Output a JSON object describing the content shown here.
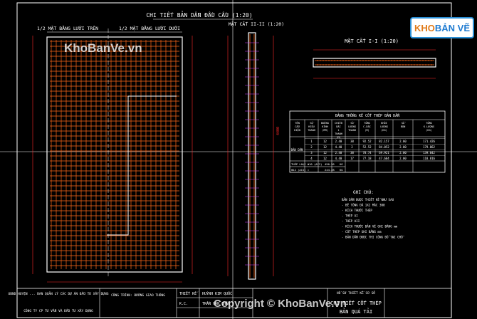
{
  "drawing": {
    "main_title": "CHI TIẾT BẢN DẪN ĐẦU CẦU (1:20)",
    "plan_top_label": "1/2 MẶT BẰNG LƯỚI TRÊN",
    "plan_bottom_label": "1/2 MẶT BẰNG LƯỚI DƯỚI",
    "section_ii_label": "MẶT CẮT II-II (1:20)",
    "section_i_label": "MẶT CẮT I-I (1:20)",
    "length_dim": "4400",
    "colors": {
      "bg": "#000000",
      "mesh": "#ff6a1a",
      "frame": "#ffffff",
      "dims": "#ff2a2a",
      "rebar_label": "#d23cff",
      "section": "#ffffff"
    }
  },
  "table": {
    "title": "BẢNG THỐNG KÊ CỐT THÉP BẢN DẪN",
    "headers": [
      "TÊN CẤU KIỆN",
      "SỐ HIỆU THANH",
      "ĐƯỜNG KÍNH (MM)",
      "CHIỀU DÀI 1 THANH (M)",
      "SỐ LƯỢNG THANH",
      "TỔNG C.DÀI (M)",
      "KHỐI LƯỢNG (KG)",
      "SỐ BẢN",
      "TỔNG K.LƯỢNG (KG)"
    ],
    "member": "BẢN DẪN",
    "rows": [
      [
        "1",
        "12",
        "2.40",
        "38",
        "92.52",
        "82.157",
        "2.00",
        "171.426"
      ],
      [
        "2",
        "12",
        "4.40",
        "2",
        "52.52",
        "84.052",
        "2.00",
        "179.862"
      ],
      [
        "3",
        "12",
        "2.40",
        "38",
        "78.74",
        "69.921",
        "2.00",
        "139.842"
      ],
      [
        "4",
        "12",
        "4.40",
        "17",
        "77.18",
        "47.684",
        "2.00",
        "118.816"
      ]
    ],
    "totals": [
      {
        "label": "THÉP LOẠI Φ10 (AII)",
        "value": "490.26",
        "unit": "KG"
      },
      {
        "label": "Φ12 (AII) =",
        "value": "244.28",
        "unit": "KG"
      }
    ]
  },
  "notes": {
    "title": "GHI CHÚ:",
    "lines": [
      "BẢN DẪN ĐƯỢC THIẾT KẾ NHƯ SAU",
      "- BÊ TÔNG ĐÁ 1X2 MÁC 300",
      "- KÍCH THƯỚC THÉP",
      "- THÉP AI",
      "- THÉP AII",
      "- KÍCH THƯỚC BẢN VẼ GHI BẰNG mm",
      "- CỐT THÉP GHI BẰNG mm",
      "- BẢN DẪN ĐƯỢC THI CÔNG ĐỔ TẠI CHỖ"
    ]
  },
  "title_block": {
    "owner": "UBND HUYỆN ... BAN QUẢN LÝ CÁC DỰ ÁN ĐẦU TƯ XÂY DỰNG",
    "consultant": "CÔNG TY CP TƯ VẤN VÀ ĐẦU TƯ XÂY DỰNG",
    "project": "CÔNG TRÌNH: ĐƯỜNG GIAO THÔNG",
    "designer_label": "THIẾT KẾ",
    "designer_name": "HUỲNH KIM QUỐC",
    "checker_label": "K.C.",
    "checker_name": "TRẦN VĂN CHÂU",
    "drawing_no_label": "HỒ SƠ THIẾT KẾ CƠ SỞ",
    "drawing_title_1": "CHI TIẾT CỐT THÉP",
    "drawing_title_2": "BẢN QUÁ TẢI"
  },
  "branding": {
    "logo_left": "KHO",
    "logo_right": "BẢN VẼ",
    "watermark": "KhoBanVe.vn",
    "watermark_bottom": "Copyright © KhoBanVe.vn"
  }
}
